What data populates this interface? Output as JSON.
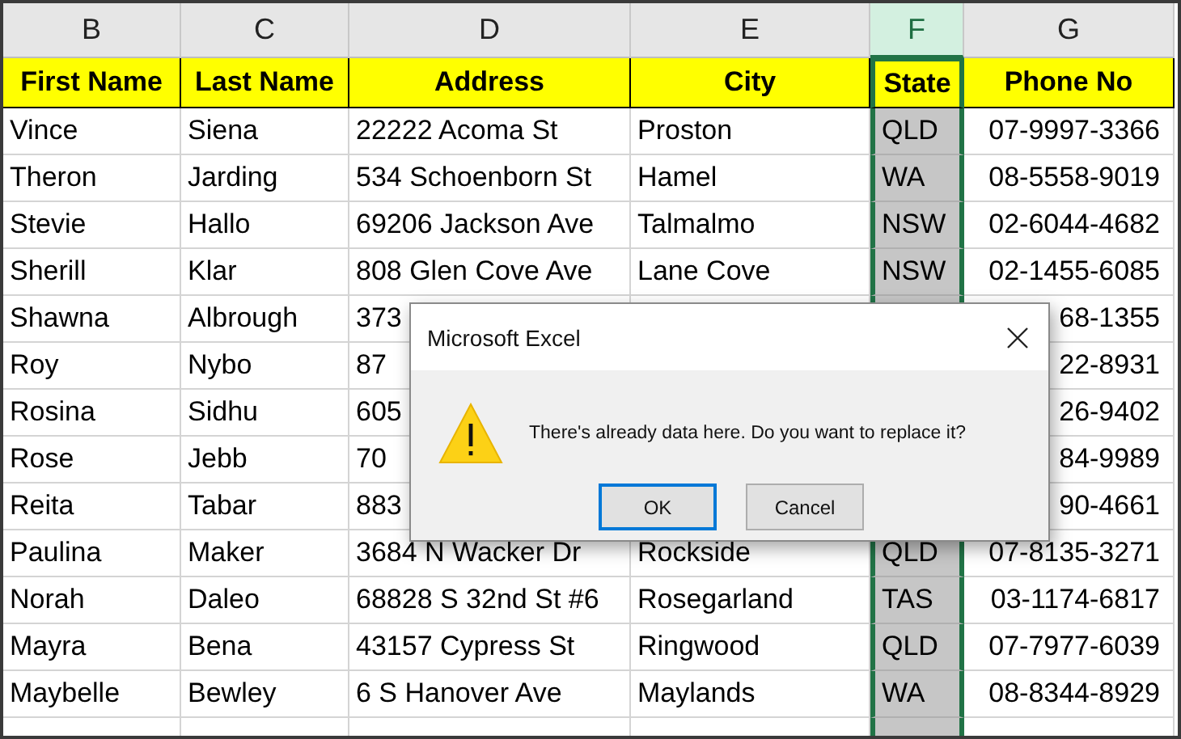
{
  "columns": [
    {
      "letter": "B",
      "selected": false
    },
    {
      "letter": "C",
      "selected": false
    },
    {
      "letter": "D",
      "selected": false
    },
    {
      "letter": "E",
      "selected": false
    },
    {
      "letter": "F",
      "selected": true
    },
    {
      "letter": "G",
      "selected": false
    }
  ],
  "headings": [
    "First Name",
    "Last Name",
    "Address",
    "City",
    "State",
    "Phone No"
  ],
  "rows": [
    {
      "cells": [
        "Vince",
        "Siena",
        "22222 Acoma St",
        "Proston",
        "QLD",
        "07-9997-3366"
      ]
    },
    {
      "cells": [
        "Theron",
        "Jarding",
        "534 Schoenborn St",
        "Hamel",
        "WA",
        "08-5558-9019"
      ]
    },
    {
      "cells": [
        "Stevie",
        "Hallo",
        "69206 Jackson Ave",
        "Talmalmo",
        "NSW",
        "02-6044-4682"
      ]
    },
    {
      "cells": [
        "Sherill",
        "Klar",
        "808 Glen Cove Ave",
        "Lane Cove",
        "NSW",
        "02-1455-6085"
      ]
    },
    {
      "cells": [
        "Shawna",
        "Albrough",
        "373",
        null,
        null,
        "68-1355"
      ]
    },
    {
      "cells": [
        "Roy",
        "Nybo",
        "87",
        null,
        null,
        "22-8931"
      ]
    },
    {
      "cells": [
        "Rosina",
        "Sidhu",
        "605",
        null,
        null,
        "26-9402"
      ]
    },
    {
      "cells": [
        "Rose",
        "Jebb",
        "70",
        null,
        null,
        "84-9989"
      ]
    },
    {
      "cells": [
        "Reita",
        "Tabar",
        "883",
        null,
        null,
        "90-4661"
      ]
    },
    {
      "cells": [
        "Paulina",
        "Maker",
        "3684 N Wacker Dr",
        "Rockside",
        "QLD",
        "07-8135-3271"
      ]
    },
    {
      "cells": [
        "Norah",
        "Daleo",
        "68828 S 32nd St #6",
        "Rosegarland",
        "TAS",
        "03-1174-6817"
      ]
    },
    {
      "cells": [
        "Mayra",
        "Bena",
        "43157 Cypress St",
        "Ringwood",
        "QLD",
        "07-7977-6039"
      ]
    },
    {
      "cells": [
        "Maybelle",
        "Bewley",
        "6 S Hanover Ave",
        "Maylands",
        "WA",
        "08-8344-8929"
      ]
    }
  ],
  "dialog": {
    "title": "Microsoft Excel",
    "message": "There's already data here. Do you want to replace it?",
    "buttons": [
      {
        "label": "OK",
        "focused": true
      },
      {
        "label": "Cancel",
        "focused": false
      }
    ]
  }
}
